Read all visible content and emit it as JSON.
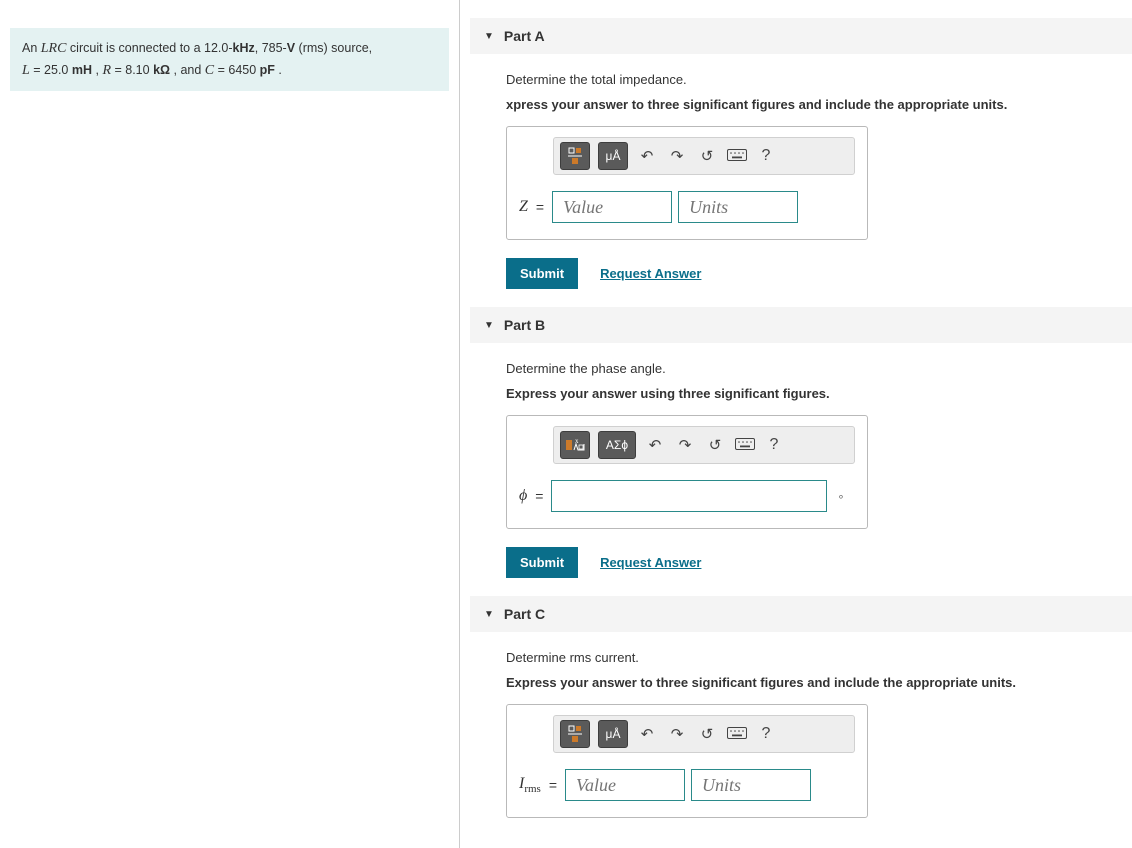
{
  "problem": {
    "prefix1": "An ",
    "var_lrc": "LRC",
    "mid1": " circuit is connected to a 12.0-",
    "b_kHz": "kHz",
    "mid2": ", 785-",
    "b_V": "V",
    "mid3": " (rms) source,",
    "line2_a": "L",
    "line2_b": " = 25.0 ",
    "unit_mH": "mH",
    "line2_c": " , ",
    "var_R": "R",
    "line2_d": " = 8.10 ",
    "unit_kO": "kΩ",
    "line2_e": " , and ",
    "var_C": "C",
    "line2_f": " = 6450 ",
    "unit_pF": "pF",
    "line2_g": " ."
  },
  "parts": {
    "a": {
      "title": "Part A",
      "prompt": "Determine the total impedance.",
      "instr": "xpress your answer to three significant figures and include the appropriate units.",
      "symbol": "Z",
      "value_ph": "Value",
      "units_ph": "Units",
      "tb_btn2": "μÅ"
    },
    "b": {
      "title": "Part B",
      "prompt": "Determine the phase angle.",
      "instr": "Express your answer using three significant figures.",
      "symbol": "ϕ",
      "tb_btn2": "ΑΣϕ",
      "suffix": "∘"
    },
    "c": {
      "title": "Part C",
      "prompt": "Determine rms current.",
      "instr": "Express your answer to three significant figures and include the appropriate units.",
      "symbol_html": "I_rms",
      "value_ph": "Value",
      "units_ph": "Units",
      "tb_btn2": "μÅ"
    }
  },
  "common": {
    "submit": "Submit",
    "request": "Request Answer",
    "help": "?"
  }
}
